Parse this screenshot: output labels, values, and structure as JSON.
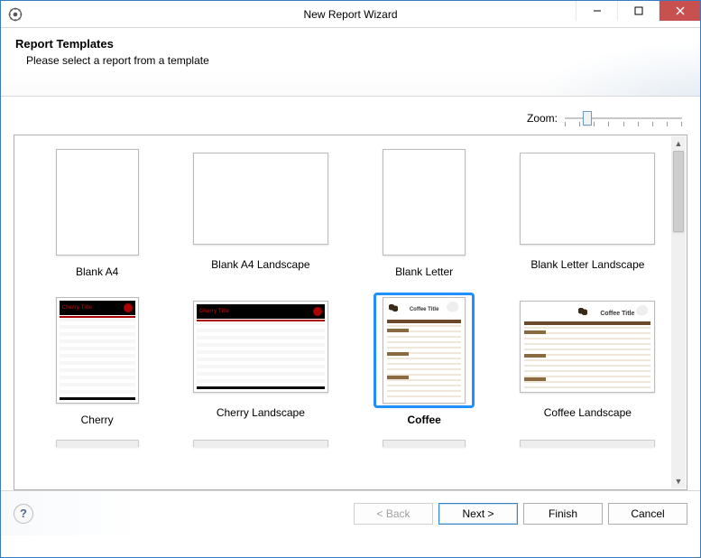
{
  "window": {
    "title": "New Report Wizard"
  },
  "header": {
    "heading": "Report Templates",
    "subtitle": "Please select a report from a template"
  },
  "zoom": {
    "label": "Zoom:"
  },
  "templates": [
    {
      "id": "blank-a4",
      "label": "Blank A4",
      "orientation": "portrait",
      "style": "blank",
      "selected": false
    },
    {
      "id": "blank-a4-landscape",
      "label": "Blank A4 Landscape",
      "orientation": "landscape",
      "style": "blank",
      "selected": false
    },
    {
      "id": "blank-letter",
      "label": "Blank Letter",
      "orientation": "portrait",
      "style": "blank",
      "selected": false
    },
    {
      "id": "blank-letter-landscape",
      "label": "Blank Letter Landscape",
      "orientation": "landscape",
      "style": "blank",
      "selected": false
    },
    {
      "id": "cherry",
      "label": "Cherry",
      "orientation": "portrait",
      "style": "cherry",
      "selected": false
    },
    {
      "id": "cherry-landscape",
      "label": "Cherry Landscape",
      "orientation": "landscape",
      "style": "cherry",
      "selected": false
    },
    {
      "id": "coffee",
      "label": "Coffee",
      "orientation": "portrait",
      "style": "coffee",
      "selected": true
    },
    {
      "id": "coffee-landscape",
      "label": "Coffee Landscape",
      "orientation": "landscape",
      "style": "coffee",
      "selected": false
    }
  ],
  "thumb_text": {
    "cherry_title": "Cherry Title",
    "coffee_title": "Coffee Title"
  },
  "buttons": {
    "back": "< Back",
    "next": "Next >",
    "finish": "Finish",
    "cancel": "Cancel"
  }
}
